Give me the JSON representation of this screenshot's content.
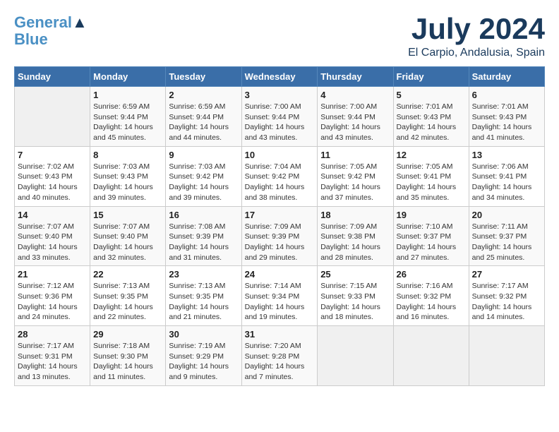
{
  "header": {
    "logo_line1": "General",
    "logo_line2": "Blue",
    "title": "July 2024",
    "subtitle": "El Carpio, Andalusia, Spain"
  },
  "days_of_week": [
    "Sunday",
    "Monday",
    "Tuesday",
    "Wednesday",
    "Thursday",
    "Friday",
    "Saturday"
  ],
  "weeks": [
    [
      {
        "day": "",
        "info": ""
      },
      {
        "day": "1",
        "info": "Sunrise: 6:59 AM\nSunset: 9:44 PM\nDaylight: 14 hours\nand 45 minutes."
      },
      {
        "day": "2",
        "info": "Sunrise: 6:59 AM\nSunset: 9:44 PM\nDaylight: 14 hours\nand 44 minutes."
      },
      {
        "day": "3",
        "info": "Sunrise: 7:00 AM\nSunset: 9:44 PM\nDaylight: 14 hours\nand 43 minutes."
      },
      {
        "day": "4",
        "info": "Sunrise: 7:00 AM\nSunset: 9:44 PM\nDaylight: 14 hours\nand 43 minutes."
      },
      {
        "day": "5",
        "info": "Sunrise: 7:01 AM\nSunset: 9:43 PM\nDaylight: 14 hours\nand 42 minutes."
      },
      {
        "day": "6",
        "info": "Sunrise: 7:01 AM\nSunset: 9:43 PM\nDaylight: 14 hours\nand 41 minutes."
      }
    ],
    [
      {
        "day": "7",
        "info": "Sunrise: 7:02 AM\nSunset: 9:43 PM\nDaylight: 14 hours\nand 40 minutes."
      },
      {
        "day": "8",
        "info": "Sunrise: 7:03 AM\nSunset: 9:43 PM\nDaylight: 14 hours\nand 39 minutes."
      },
      {
        "day": "9",
        "info": "Sunrise: 7:03 AM\nSunset: 9:42 PM\nDaylight: 14 hours\nand 39 minutes."
      },
      {
        "day": "10",
        "info": "Sunrise: 7:04 AM\nSunset: 9:42 PM\nDaylight: 14 hours\nand 38 minutes."
      },
      {
        "day": "11",
        "info": "Sunrise: 7:05 AM\nSunset: 9:42 PM\nDaylight: 14 hours\nand 37 minutes."
      },
      {
        "day": "12",
        "info": "Sunrise: 7:05 AM\nSunset: 9:41 PM\nDaylight: 14 hours\nand 35 minutes."
      },
      {
        "day": "13",
        "info": "Sunrise: 7:06 AM\nSunset: 9:41 PM\nDaylight: 14 hours\nand 34 minutes."
      }
    ],
    [
      {
        "day": "14",
        "info": "Sunrise: 7:07 AM\nSunset: 9:40 PM\nDaylight: 14 hours\nand 33 minutes."
      },
      {
        "day": "15",
        "info": "Sunrise: 7:07 AM\nSunset: 9:40 PM\nDaylight: 14 hours\nand 32 minutes."
      },
      {
        "day": "16",
        "info": "Sunrise: 7:08 AM\nSunset: 9:39 PM\nDaylight: 14 hours\nand 31 minutes."
      },
      {
        "day": "17",
        "info": "Sunrise: 7:09 AM\nSunset: 9:39 PM\nDaylight: 14 hours\nand 29 minutes."
      },
      {
        "day": "18",
        "info": "Sunrise: 7:09 AM\nSunset: 9:38 PM\nDaylight: 14 hours\nand 28 minutes."
      },
      {
        "day": "19",
        "info": "Sunrise: 7:10 AM\nSunset: 9:37 PM\nDaylight: 14 hours\nand 27 minutes."
      },
      {
        "day": "20",
        "info": "Sunrise: 7:11 AM\nSunset: 9:37 PM\nDaylight: 14 hours\nand 25 minutes."
      }
    ],
    [
      {
        "day": "21",
        "info": "Sunrise: 7:12 AM\nSunset: 9:36 PM\nDaylight: 14 hours\nand 24 minutes."
      },
      {
        "day": "22",
        "info": "Sunrise: 7:13 AM\nSunset: 9:35 PM\nDaylight: 14 hours\nand 22 minutes."
      },
      {
        "day": "23",
        "info": "Sunrise: 7:13 AM\nSunset: 9:35 PM\nDaylight: 14 hours\nand 21 minutes."
      },
      {
        "day": "24",
        "info": "Sunrise: 7:14 AM\nSunset: 9:34 PM\nDaylight: 14 hours\nand 19 minutes."
      },
      {
        "day": "25",
        "info": "Sunrise: 7:15 AM\nSunset: 9:33 PM\nDaylight: 14 hours\nand 18 minutes."
      },
      {
        "day": "26",
        "info": "Sunrise: 7:16 AM\nSunset: 9:32 PM\nDaylight: 14 hours\nand 16 minutes."
      },
      {
        "day": "27",
        "info": "Sunrise: 7:17 AM\nSunset: 9:32 PM\nDaylight: 14 hours\nand 14 minutes."
      }
    ],
    [
      {
        "day": "28",
        "info": "Sunrise: 7:17 AM\nSunset: 9:31 PM\nDaylight: 14 hours\nand 13 minutes."
      },
      {
        "day": "29",
        "info": "Sunrise: 7:18 AM\nSunset: 9:30 PM\nDaylight: 14 hours\nand 11 minutes."
      },
      {
        "day": "30",
        "info": "Sunrise: 7:19 AM\nSunset: 9:29 PM\nDaylight: 14 hours\nand 9 minutes."
      },
      {
        "day": "31",
        "info": "Sunrise: 7:20 AM\nSunset: 9:28 PM\nDaylight: 14 hours\nand 7 minutes."
      },
      {
        "day": "",
        "info": ""
      },
      {
        "day": "",
        "info": ""
      },
      {
        "day": "",
        "info": ""
      }
    ]
  ]
}
